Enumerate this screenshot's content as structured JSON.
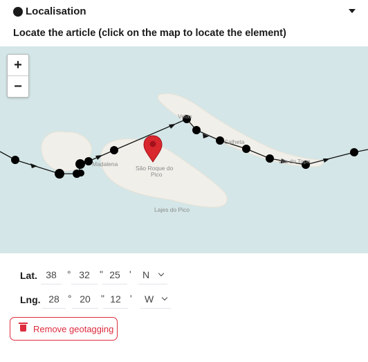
{
  "section": {
    "title": "Localisation",
    "icon": "compass-icon"
  },
  "instruction": "Locate the article (click on the map to locate the element)",
  "map": {
    "zoom_in_label": "+",
    "zoom_out_label": "−",
    "places": [
      "Madalena",
      "São Roque do",
      "Pico",
      "Lajes do Pico",
      "Velas",
      "Calheta",
      "Vila do Topo"
    ],
    "marker_icon": "map-pin-icon",
    "colors": {
      "water": "#d4e6e7",
      "land": "#f1efe9",
      "track": "#111111",
      "marker": "#d9272e"
    }
  },
  "latitude": {
    "label": "Lat.",
    "degrees": "38",
    "deg_unit": "°",
    "minutes": "32",
    "min_unit": "\"",
    "seconds": "25",
    "sec_unit": "'",
    "direction": "N"
  },
  "longitude": {
    "label": "Lng.",
    "degrees": "28",
    "deg_unit": "°",
    "minutes": "20",
    "min_unit": "\"",
    "seconds": "12",
    "sec_unit": "'",
    "direction": "W"
  },
  "remove_button": {
    "label": "Remove geotagging",
    "icon": "trash-icon",
    "color": "#dc2c3d"
  }
}
